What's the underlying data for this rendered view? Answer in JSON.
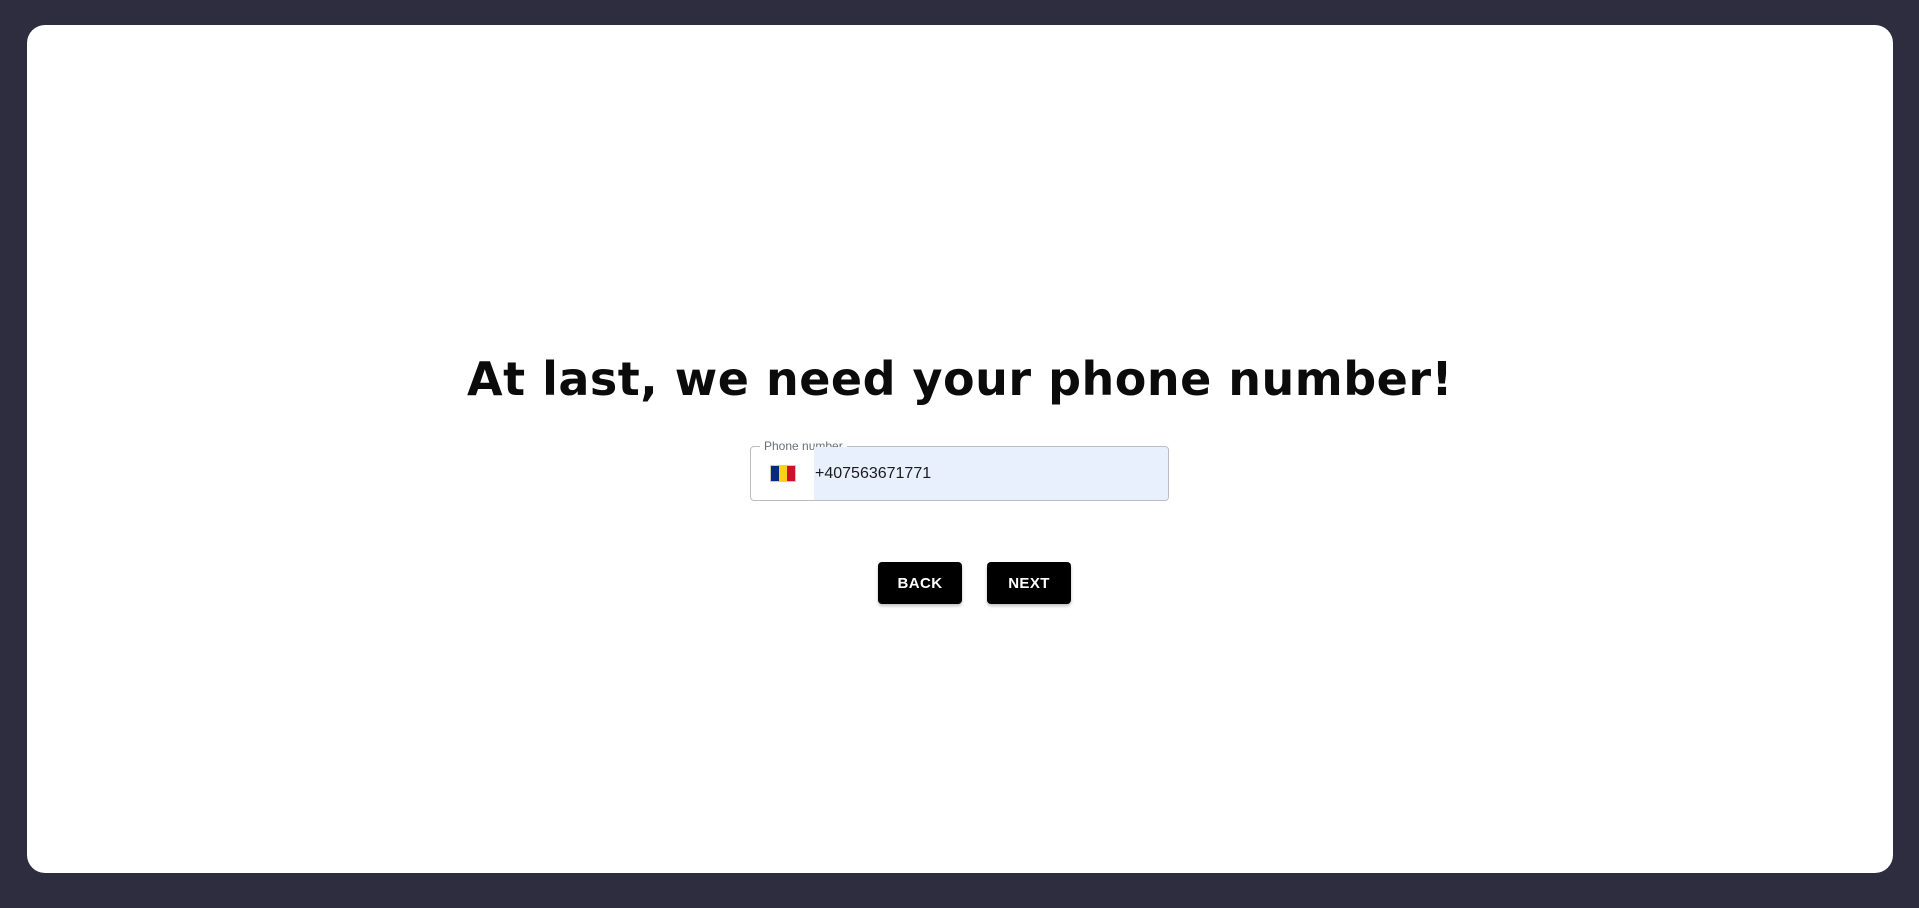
{
  "page": {
    "title": "At last, we need your phone number!"
  },
  "phone_field": {
    "legend": "Phone number",
    "value": "+407563671771",
    "country_flag_icon": "romania-flag-icon",
    "flag_colors": [
      "#002b7f",
      "#fcd116",
      "#ce1126"
    ]
  },
  "actions": {
    "back_label": "BACK",
    "next_label": "NEXT"
  },
  "colors": {
    "backdrop": "#2e2d40",
    "card": "#ffffff",
    "button": "#000000",
    "input_autofill": "#e8f0fe"
  }
}
